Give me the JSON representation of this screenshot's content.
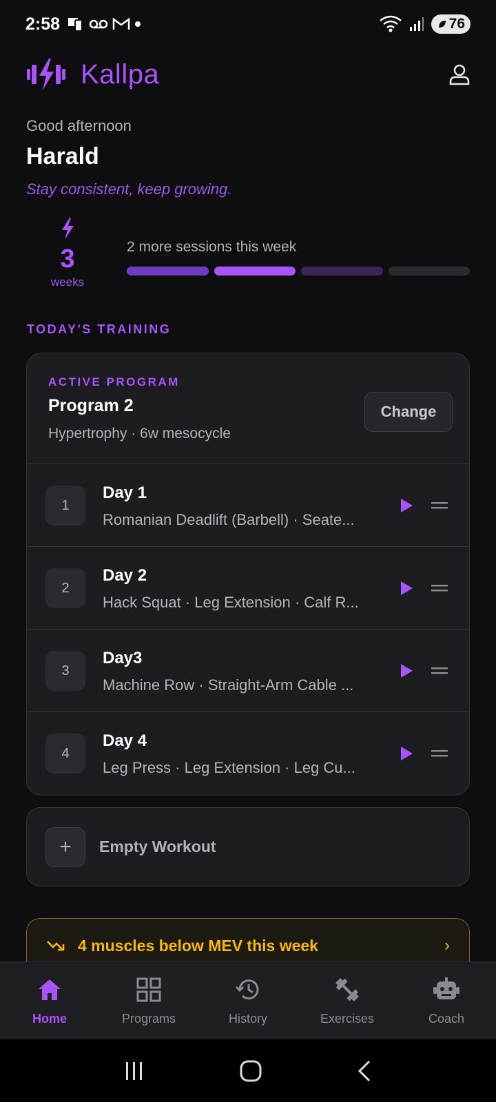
{
  "status_bar": {
    "time": "2:58",
    "battery": "76"
  },
  "app": {
    "name": "Kallpa"
  },
  "greeting": "Good afternoon",
  "user_name": "Harald",
  "tagline": "Stay consistent, keep growing.",
  "streak": {
    "count": "3",
    "unit": "weeks"
  },
  "sessions_text": "2 more sessions this week",
  "progress_segments": [
    "#6d3bc2",
    "#a855f7",
    "#3a2458",
    "#2a2a30"
  ],
  "section_title": "TODAY'S TRAINING",
  "program": {
    "label": "ACTIVE PROGRAM",
    "name": "Program 2",
    "meta": "Hypertrophy · 6w mesocycle",
    "change_label": "Change",
    "days": [
      {
        "num": "1",
        "title": "Day 1",
        "exercises": "Romanian Deadlift (Barbell) · Seate..."
      },
      {
        "num": "2",
        "title": "Day 2",
        "exercises": "Hack Squat · Leg Extension · Calf R..."
      },
      {
        "num": "3",
        "title": "Day3",
        "exercises": "Machine Row · Straight-Arm Cable ..."
      },
      {
        "num": "4",
        "title": "Day 4",
        "exercises": "Leg Press · Leg Extension · Leg Cu..."
      }
    ]
  },
  "empty_workout": {
    "icon": "+",
    "label": "Empty Workout"
  },
  "alert": {
    "text": "4 muscles below MEV this week",
    "chevron": "›"
  },
  "nav": {
    "home": "Home",
    "programs": "Programs",
    "history": "History",
    "exercises": "Exercises",
    "coach": "Coach"
  },
  "colors": {
    "accent": "#a855f7",
    "warning": "#f5b90e",
    "background": "#0e0e11",
    "card": "#1c1c21"
  }
}
